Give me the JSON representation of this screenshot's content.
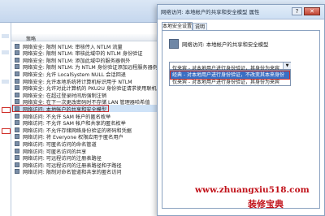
{
  "policy_list": {
    "header": "策略",
    "rows": [
      "网络安全: 限制 NTLM: 审核传入 NTLM 流量",
      "网络安全: 限制 NTLM: 审核此域中的 NTLM 身份验证",
      "网络安全: 限制 NTLM: 添加此域中的服务器例外",
      "网络安全: 限制 NTLM: 为 NTLM 身份验证添加远程服务器例外",
      "网络安全: 允许 LocalSystem NULL 会话回退",
      "网络安全: 允许本地系统将计算机标识用于 NTLM",
      "网络安全: 允许对此计算机的 PKU2U 身份验证请求使用联机标识",
      "网络安全: 在超过登录时间后强制注销",
      "网络安全: 在下一次更改密码时不存储 LAN 管理器哈希值",
      "网络访问: 本地帐户的共享和安全模型",
      "网络访问: 不允许 SAM 帐户的匿名枚举",
      "网络访问: 不允许 SAM 帐户和共享的匿名枚举",
      "网络访问: 不允许存储网络身份验证的密码和凭据",
      "网络访问: 将 Everyone 权限应用于匿名用户",
      "网络访问: 可匿名访问的命名管道",
      "网络访问: 可匿名访问的共享",
      "网络访问: 可远程访问的注册表路径",
      "网络访问: 可远程访问的注册表路径和子路径",
      "网络访问: 限制对命名管道和共享的匿名访问"
    ],
    "selected_index": 9
  },
  "dialog": {
    "title": "网络访问: 本地帐户的共享和安全模型 属性",
    "help": "?",
    "close": "✕",
    "tabs": [
      "本地安全设置",
      "说明"
    ],
    "policy_name": "网络访问: 本地帐户的共享和安全模型",
    "select_value": "仅来宾 - 对本地用户进行身份验证，其身份为来宾",
    "options": [
      "经典 - 对本地用户进行身份验证，不改变其本来身份",
      "仅来宾 - 对本地用户进行身份验证，其身份为来宾"
    ]
  },
  "watermark": {
    "url": "www.zhuangxiu518.com",
    "text": "装修宝典"
  }
}
